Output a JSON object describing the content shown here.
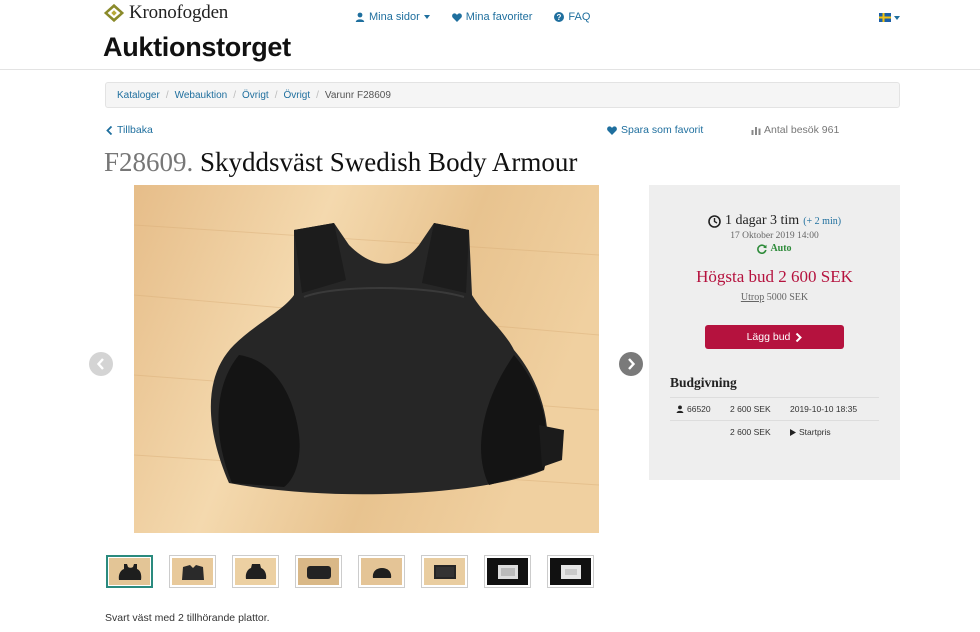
{
  "brand": {
    "name": "Kronofogden",
    "site_title": "Auktionstorget"
  },
  "topnav": {
    "my_pages": "Mina sidor",
    "favorites": "Mina favoriter",
    "faq": "FAQ"
  },
  "breadcrumb": [
    "Kataloger",
    "Webauktion",
    "Övrigt",
    "Övrigt",
    "Varunr F28609"
  ],
  "actions": {
    "back": "Tillbaka",
    "save_favorite": "Spara som favorit",
    "visits": "Antal besök 961"
  },
  "item": {
    "number": "F28609.",
    "name": "Skyddsväst Swedish Body Armour",
    "description": "Svart väst med 2 tillhörande plattor."
  },
  "auction": {
    "time_left": "1 dagar 3 tim",
    "time_extension": "(+ 2 min)",
    "end_date": "17 Oktober 2019 14:00",
    "auto_label": "Auto",
    "highest_bid": "Högsta bud 2 600 SEK",
    "reserve_label": "Utrop",
    "reserve_value": "5000 SEK",
    "bid_button": "Lägg bud"
  },
  "bidding": {
    "heading": "Budgivning",
    "rows": [
      {
        "bidder": "66520",
        "amount": "2 600 SEK",
        "info": "2019-10-10 18:35"
      },
      {
        "bidder": "",
        "amount": "2 600 SEK",
        "info": "Startpris"
      }
    ]
  },
  "thumbnails": {
    "count": 8,
    "selected_index": 0
  },
  "colors": {
    "link": "#1f6f9e",
    "accent": "#b5123e",
    "auto": "#2e8b3a",
    "thumb_selected": "#2a8a7e"
  }
}
